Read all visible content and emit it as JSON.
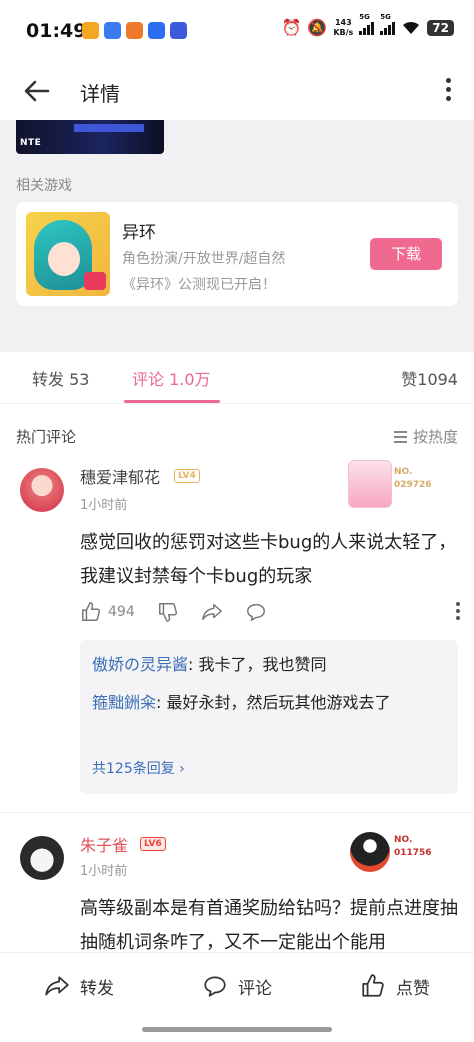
{
  "status": {
    "time": "01:49",
    "net_speed": "143",
    "net_unit": "KB/s",
    "sig1": "5G",
    "sig2": "5G",
    "battery": "72",
    "app_colors": [
      "#f5a623",
      "#3a7bf2",
      "#f07a2b",
      "#2b6ef2",
      "#3c5bd8"
    ]
  },
  "header": {
    "title": "详情"
  },
  "banner": {
    "text": "NTE"
  },
  "related": {
    "label": "相关游戏",
    "game": {
      "name": "异环",
      "tags": "角色扮演/开放世界/超自然",
      "desc": "《异环》公测现已开启！",
      "download_label": "下载"
    }
  },
  "tabs": {
    "forward": "转发 53",
    "comments": "评论 1.0万",
    "likes": "赞1094"
  },
  "hot_comments": {
    "title": "热门评论",
    "sort_label": "按热度"
  },
  "comments": [
    {
      "user": "穗爱津郁花",
      "level": "LV4",
      "time": "1小时前",
      "fan_no_label": "NO.",
      "fan_no": "029726",
      "text": "感觉回收的惩罚对这些卡bug的人来说太轻了，我建议封禁每个卡bug的玩家",
      "like_count": "494",
      "replies": [
        {
          "user": "傲娇の灵异酱",
          "text": ": 我卡了，我也赞同"
        },
        {
          "user": "箍黜銂籴",
          "text": ": 最好永封，然后玩其他游戏去了"
        }
      ],
      "reply_more": "共125条回复 ›"
    },
    {
      "user": "朱子雀",
      "level": "LV6",
      "time": "1小时前",
      "fan_no_label": "NO.",
      "fan_no": "011756",
      "text": "高等级副本是有首通奖励给钻吗？提前点进度抽抽随机词条咋了，又不一定能出个能用"
    }
  ],
  "bottom_bar": {
    "forward": "转发",
    "comment": "评论",
    "like": "点赞"
  }
}
